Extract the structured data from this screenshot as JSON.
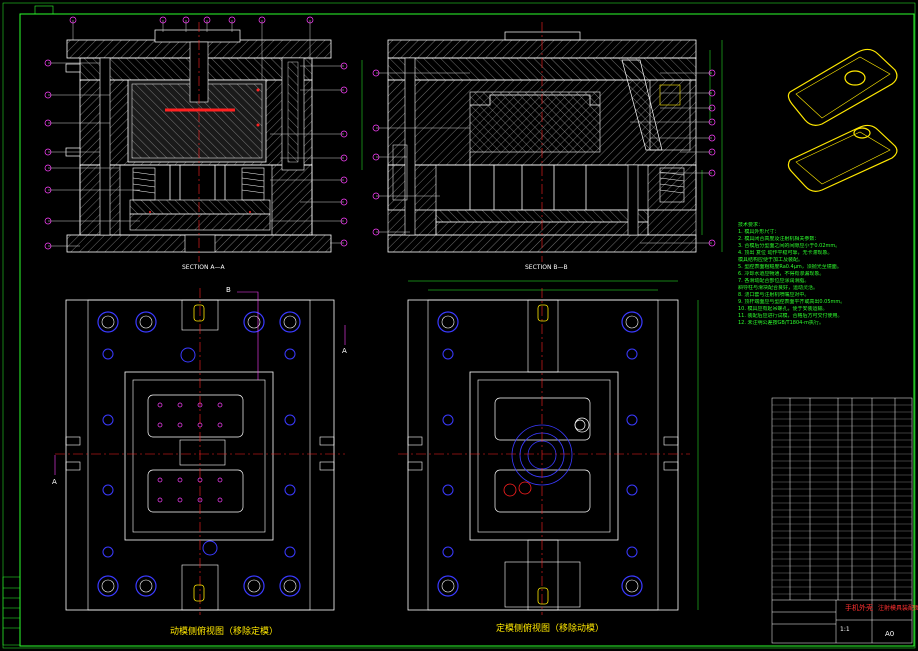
{
  "drawing": {
    "section_a_label": "SECTION A—A",
    "section_b_label": "SECTION B—B",
    "moving_half_caption": "动模侧俯视图（移除定模）",
    "fixed_half_caption": "定模侧俯视图（移除动模）",
    "section_marker_a": "A",
    "section_marker_b": "B"
  },
  "notes": {
    "heading": "技术要求：",
    "lines": [
      "1. 模具外形尺寸：",
      "2. 模具闭合高度及注射机相关参数：",
      "3. 合模后分型面之间的间隙应小于0.02mm。",
      "4. 顶出 复位 动作平稳可靠，无卡滞现象。",
      "   模具结构应便于加工及装配。",
      "5. 型腔表面粗糙度Ra0.4μm，须抛光至镜面。",
      "6. 冷却水道应畅通，不得有渗漏现象。",
      "7. 各滑动配合部位应涂润滑脂。",
      "   斜导柱与滑块配合良好，运动灵活。",
      "8. 浇口套与注射机喷嘴应对中。",
      "9. 顶杆端面应与型腔表面平齐或高出0.05mm。",
      "10. 模具应有起吊螺孔，便于安装运输。",
      "11. 装配后应进行试模，合格后方可交付使用。",
      "12. 未注明公差按GB/T1804-m执行。"
    ]
  },
  "title_block": {
    "title": "手机外壳",
    "subtitle": "注射模具装配图",
    "scale": "1:1",
    "sheet": "A0"
  },
  "colors": {
    "background": "#000000",
    "outline": "#ffffff",
    "centerline": "#ff2020",
    "hatch": "#cfcfcf",
    "dimension": "#2dff2d",
    "callout": "#ff40ff",
    "blue_part": "#3a3aff",
    "yellow_part": "#ffe800",
    "border": "#2dff2d"
  }
}
